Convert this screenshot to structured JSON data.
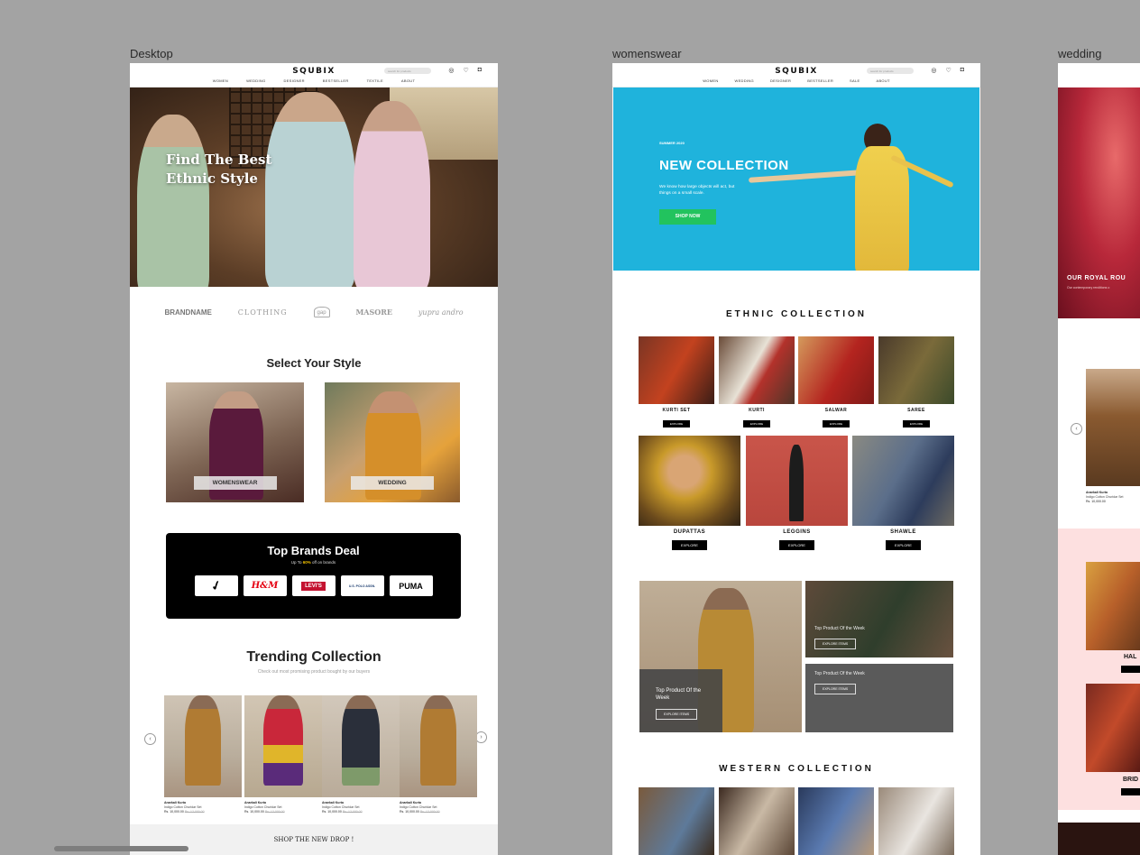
{
  "frames": {
    "desktop": "Desktop",
    "womenswear": "womenswear",
    "wedding": "wedding"
  },
  "header": {
    "logo": "SQUBIX",
    "search_placeholder": "search for products",
    "nav_desktop": [
      "WOMEN",
      "WEDDING",
      "DESIGNER",
      "BESTSELLER",
      "TEXTILE",
      "ABOUT"
    ],
    "nav_womens": [
      "WOMEN",
      "WEDDING",
      "DESIGNER",
      "BESTSELLER",
      "SALE",
      "ABOUT"
    ]
  },
  "desktop": {
    "hero_title_1": "Find The Best",
    "hero_title_2": "Ethnic Style",
    "brands": [
      "BRANDNAME",
      "CLOTHING",
      "gap",
      "MASORE",
      "yupra andro"
    ],
    "style_title": "Select Your Style",
    "style_cards": [
      "WOMENSWEAR",
      "WEDDING"
    ],
    "deal": {
      "title": "Top Brands Deal",
      "sub_pre": "Up To ",
      "sub_pct": "60%",
      "sub_post": " off on brands",
      "logos": [
        "nike",
        "H&M",
        "LEVI'S",
        "U.S. POLO ASSN.",
        "PUMA"
      ]
    },
    "trending": {
      "title": "Trending Collection",
      "subtitle": "Check out most promising product bought by our buyers",
      "products": [
        {
          "name": "Anarkali Kurta",
          "desc": "Indigo Cotton Churidar Set",
          "price": "Rs. 10,000.00",
          "old": "Rs. 12,000.00"
        },
        {
          "name": "Anarkali Kurta",
          "desc": "Indigo Cotton Churidar Set",
          "price": "Rs. 10,000.00",
          "old": "Rs. 12,000.00"
        },
        {
          "name": "Anarkali Kurta",
          "desc": "Indigo Cotton Churidar Set",
          "price": "Rs. 10,000.00",
          "old": "Rs. 12,000.00"
        },
        {
          "name": "Anarkali Kurta",
          "desc": "Indigo Cotton Churidar Set",
          "price": "Rs. 10,000.00",
          "old": "Rs. 12,000.00"
        }
      ]
    },
    "drop": "SHOP THE NEW DROP !"
  },
  "womenswear": {
    "hero_small": "SUMMER 2020",
    "hero_title": "NEW COLLECTION",
    "hero_body": "We know how large objects will act, but things on a small scale.",
    "hero_btn": "SHOP NOW",
    "ethnic_title": "ETHNIC COLLECTION",
    "row1": [
      {
        "label": "KURTI SET",
        "btn": "EXPLORE"
      },
      {
        "label": "KURTI",
        "btn": "EXPLORE"
      },
      {
        "label": "SALWAR",
        "btn": "EXPLORE"
      },
      {
        "label": "SAREE",
        "btn": "EXPLORE"
      }
    ],
    "row2": [
      {
        "label": "DUPATTAS",
        "btn": "EXPLORE"
      },
      {
        "label": "LEGGINS",
        "btn": "EXPLORE"
      },
      {
        "label": "SHAWLE",
        "btn": "EXPLORE"
      }
    ],
    "promo": {
      "big_title": "Top Product Of the Week",
      "big_btn": "EXPLORE ITEMS",
      "tr_title": "Top Product Of the Week",
      "tr_btn": "EXPLORE ITEMS",
      "br_title": "Top Product Of the Week",
      "br_btn": "EXPLORE ITEMS"
    },
    "western_title": "WESTERN COLLECTION"
  },
  "wedding": {
    "hero_title": "OUR ROYAL ROU",
    "hero_sub": "Our contemporary renditions o",
    "product": {
      "name": "Anarkali Kurta",
      "desc": "Indigo Cotton Churidar Set",
      "price": "Rs. 10,000.00"
    },
    "cat1": "HAL",
    "cat2": "BRID"
  }
}
